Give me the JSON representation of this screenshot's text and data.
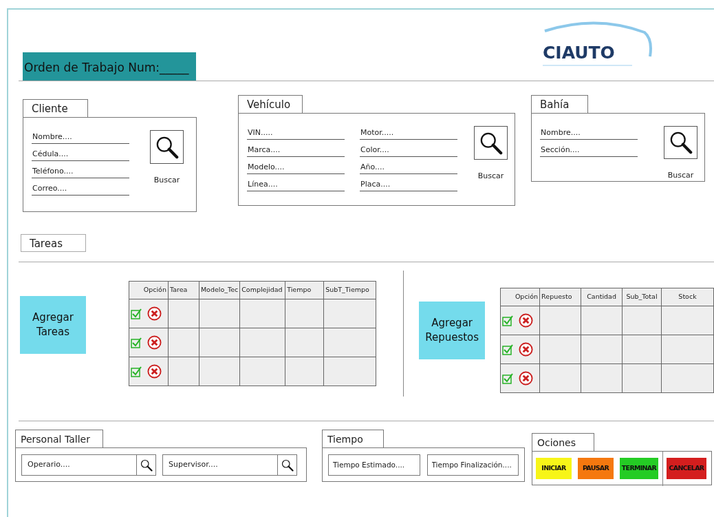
{
  "header": {
    "title": "Orden de Trabajo Num:_____"
  },
  "logo": {
    "text": "CIAUTO"
  },
  "panels": [
    {
      "title": "Cliente",
      "columns": [
        [
          {
            "placeholder": "Nombre...."
          },
          {
            "placeholder": "Cédula...."
          },
          {
            "placeholder": "Teléfono...."
          },
          {
            "placeholder": "Correo...."
          }
        ]
      ],
      "button": "Buscar"
    },
    {
      "title": "Vehículo",
      "columns": [
        [
          {
            "placeholder": "VIN....."
          },
          {
            "placeholder": "Marca...."
          },
          {
            "placeholder": "Modelo...."
          },
          {
            "placeholder": "Línea...."
          }
        ],
        [
          {
            "placeholder": "Motor....."
          },
          {
            "placeholder": "Color...."
          },
          {
            "placeholder": "Año...."
          },
          {
            "placeholder": "Placa...."
          }
        ]
      ],
      "button": "Buscar"
    },
    {
      "title": "Bahía",
      "columns": [
        [
          {
            "placeholder": "Nombre...."
          },
          {
            "placeholder": "Sección...."
          }
        ]
      ],
      "button": "Buscar"
    }
  ],
  "tasks_tab": {
    "title": "Tareas"
  },
  "grids": [
    {
      "button": "Agregar Tareas",
      "columns": [
        "Opción",
        "Tarea",
        "Modelo_Tec",
        "Complejidad",
        "Tiempo",
        "SubT_Tiempo"
      ],
      "rows": [
        {
          "kind": "editable"
        },
        {
          "kind": "editable"
        },
        {
          "kind": "editable"
        }
      ]
    },
    {
      "button": "Agregar Repuestos",
      "columns": [
        "Opción",
        "Repuesto",
        "Cantidad",
        "Sub_Total",
        "Stock"
      ],
      "rows": [
        {
          "kind": "editable"
        },
        {
          "kind": "editable"
        },
        {
          "kind": "editable"
        }
      ]
    }
  ],
  "staff": {
    "title": "Personal Taller",
    "fields": [
      {
        "placeholder": "Operario...."
      },
      {
        "placeholder": "Supervisor...."
      }
    ]
  },
  "time": {
    "title": "Tiempo",
    "fields": [
      {
        "placeholder": "Tiempo Estimado...."
      },
      {
        "placeholder": "Tiempo Finalización...."
      }
    ]
  },
  "actions": {
    "title": "Ociones",
    "buttons": [
      {
        "label": "INICIAR",
        "color": "#f7f518",
        "separated": false
      },
      {
        "label": "PAUSAR",
        "color": "#f5780f",
        "separated": false
      },
      {
        "label": "TERMINAR",
        "color": "#24cc24",
        "separated": false
      },
      {
        "label": "CANCELAR",
        "color": "#d41e1e",
        "separated": true
      }
    ]
  }
}
